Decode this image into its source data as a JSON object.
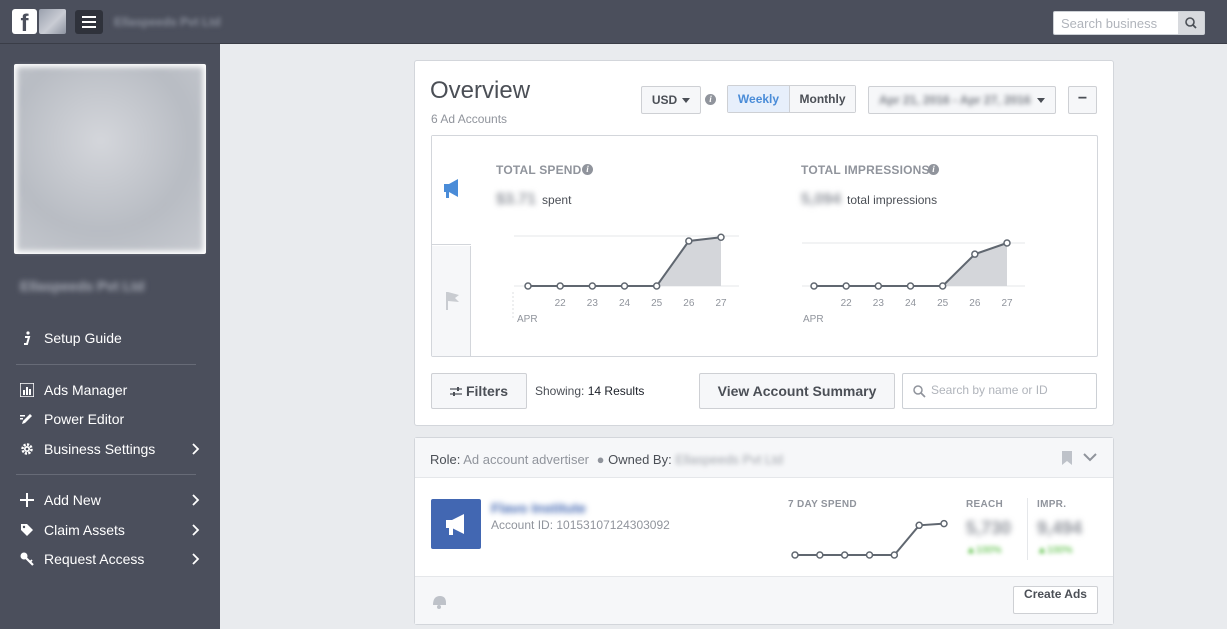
{
  "topbar": {
    "logo_glyph": "f",
    "business_name": "Ellaspeeds Pvt Ltd",
    "search_placeholder": "Search business"
  },
  "sidebar": {
    "profile_name": "Ellaspeeds Pvt Ltd",
    "items": [
      {
        "label": "Setup Guide",
        "icon": "info-icon"
      },
      {
        "label": "Ads Manager",
        "icon": "bar-chart-icon"
      },
      {
        "label": "Power Editor",
        "icon": "edit-icon"
      },
      {
        "label": "Business Settings",
        "icon": "gear-icon"
      },
      {
        "label": "Add New",
        "icon": "plus-icon"
      },
      {
        "label": "Claim Assets",
        "icon": "tag-icon"
      },
      {
        "label": "Request Access",
        "icon": "key-icon"
      }
    ]
  },
  "overview": {
    "title": "Overview",
    "subtitle": "6 Ad Accounts",
    "currency": "USD",
    "weekly_label": "Weekly",
    "monthly_label": "Monthly",
    "date_range": "Apr 21, 2016 - Apr 27, 2016",
    "collapse_label": "−",
    "spend": {
      "title": "TOTAL SPEND",
      "value": "$3.71",
      "suffix": "spent"
    },
    "impressions": {
      "title": "TOTAL IMPRESSIONS",
      "value": "5,094",
      "suffix": "total impressions"
    },
    "filters_label": "Filters",
    "showing_label": "Showing:",
    "showing_count": "14 Results",
    "view_summary_label": "View Account Summary",
    "search_placeholder": "Search by name or ID"
  },
  "chart_data": [
    {
      "type": "area",
      "title": "TOTAL SPEND",
      "x": [
        "21",
        "22",
        "23",
        "24",
        "25",
        "26",
        "27"
      ],
      "x_ticks_shown": [
        "22",
        "23",
        "24",
        "25",
        "26",
        "27"
      ],
      "month_label": "APR",
      "values": [
        0,
        0,
        0,
        0,
        0,
        1.8,
        1.95
      ],
      "y_ticks": [
        "0",
        "2"
      ],
      "ylim": [
        0,
        2
      ]
    },
    {
      "type": "area",
      "title": "TOTAL IMPRESSIONS",
      "x": [
        "21",
        "22",
        "23",
        "24",
        "25",
        "26",
        "27"
      ],
      "x_ticks_shown": [
        "22",
        "23",
        "24",
        "25",
        "26",
        "27"
      ],
      "month_label": "APR",
      "values": [
        0,
        0,
        0,
        0,
        0,
        3700,
        5000
      ],
      "y_ticks": [
        "0",
        "5,000"
      ],
      "ylim": [
        0,
        5000
      ]
    },
    {
      "type": "line",
      "title": "7 DAY SPEND",
      "values": [
        0,
        0,
        0,
        0,
        0,
        1.8,
        1.9
      ],
      "ylim": [
        0,
        2
      ]
    }
  ],
  "account": {
    "role_label": "Role:",
    "role_value": "Ad account advertiser",
    "owned_by_label": "Owned By:",
    "owned_by_value": "Ellaspeeds Pvt Ltd",
    "name": "Flavo Institute",
    "account_id": "Account ID: 10153107124303092",
    "seven_day_label": "7 DAY SPEND",
    "reach_label": "REACH",
    "reach_value": "5,730",
    "reach_change": "▲100%",
    "impr_label": "IMPR.",
    "impr_value": "9,494",
    "impr_change": "▲100%",
    "create_ads_label": "Create Ads"
  },
  "colors": {
    "topbar_bg": "#4b4f5c",
    "accent_blue": "#4267b2",
    "weekly_active": "#4a8cd8",
    "positive_green": "#42b72a"
  }
}
